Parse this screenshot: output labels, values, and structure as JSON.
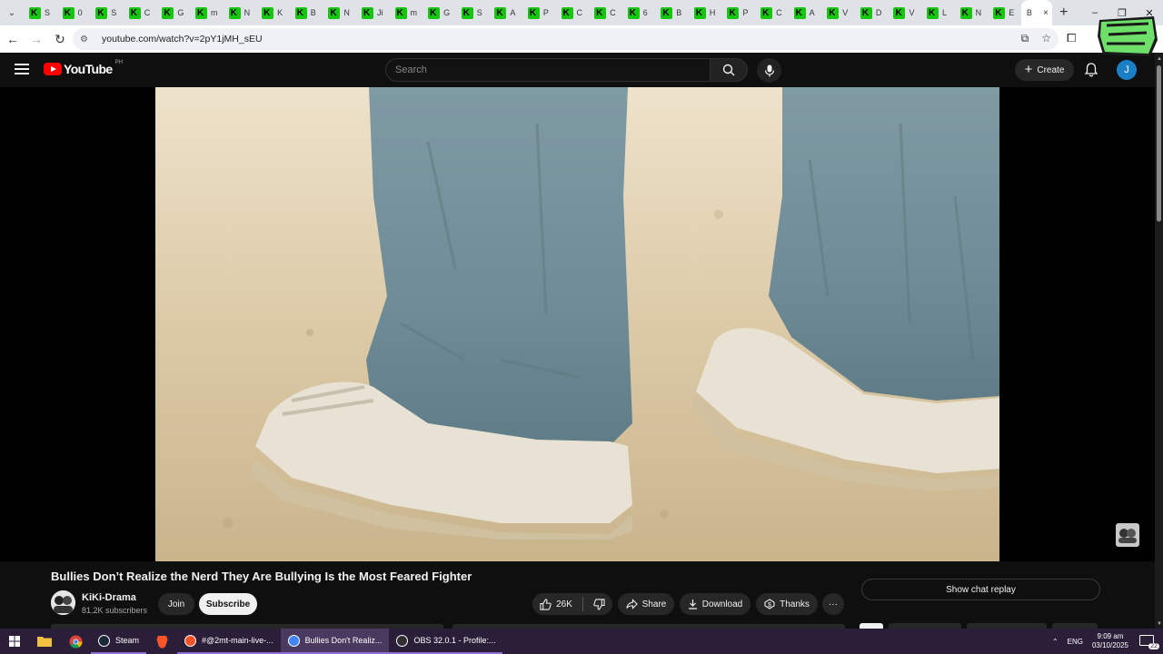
{
  "browser": {
    "tabs": [
      {
        "label": "S"
      },
      {
        "label": "0"
      },
      {
        "label": "S"
      },
      {
        "label": "C"
      },
      {
        "label": "G"
      },
      {
        "label": "m"
      },
      {
        "label": "N"
      },
      {
        "label": "K"
      },
      {
        "label": "B"
      },
      {
        "label": "N"
      },
      {
        "label": "Ji"
      },
      {
        "label": "m"
      },
      {
        "label": "G"
      },
      {
        "label": "S"
      },
      {
        "label": "A"
      },
      {
        "label": "P"
      },
      {
        "label": "C"
      },
      {
        "label": "C"
      },
      {
        "label": "6"
      },
      {
        "label": "B"
      },
      {
        "label": "H"
      },
      {
        "label": "P"
      },
      {
        "label": "C"
      },
      {
        "label": "A"
      },
      {
        "label": "V"
      },
      {
        "label": "D"
      },
      {
        "label": "V"
      },
      {
        "label": "L"
      },
      {
        "label": "N"
      },
      {
        "label": "E"
      }
    ],
    "active_tab": {
      "label": "B",
      "close": "×"
    },
    "new_tab": "+",
    "window_controls": {
      "minimize": "–",
      "restore": "❐",
      "close": "✕"
    },
    "url": "youtube.com/watch?v=2pY1jMH_sEU"
  },
  "youtube": {
    "logo_text": "YouTube",
    "country_code": "PH",
    "search_placeholder": "Search",
    "create_label": "Create",
    "avatar_letter": "J",
    "video": {
      "title": "Bullies Don’t Realize the Nerd They Are Bullying Is the Most Feared Fighter"
    },
    "channel": {
      "name": "KiKi-Drama",
      "subscribers": "81.2K subscribers"
    },
    "join_label": "Join",
    "subscribe_label": "Subscribe",
    "likes": "26K",
    "share_label": "Share",
    "download_label": "Download",
    "thanks_label": "Thanks",
    "more_label": "···",
    "chat_replay_label": "Show chat replay"
  },
  "taskbar": {
    "apps": [
      {
        "label": "Steam"
      },
      {
        "label": "#@2mt-main-live-..."
      },
      {
        "label": "Bullies Don't Realiz..."
      },
      {
        "label": "OBS 32.0.1 - Profile:..."
      }
    ],
    "language": "ENG",
    "time": "9:09 am",
    "date": "03/10/2025",
    "notification_count": "22"
  },
  "colors": {
    "youtube_red": "#ff0000",
    "background": "#0f0f0f",
    "taskbar": "#2b1e39",
    "tab_favicon": "#16c60c"
  }
}
